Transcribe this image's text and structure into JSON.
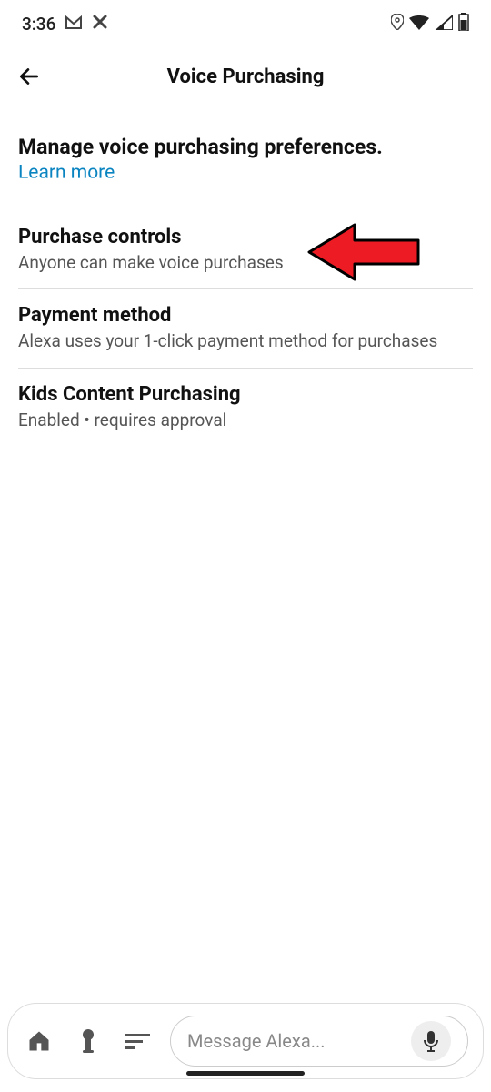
{
  "status": {
    "time": "3:36",
    "icons": {
      "gmail": "M",
      "x": "X"
    }
  },
  "header": {
    "title": "Voice Purchasing"
  },
  "intro": {
    "text": "Manage voice purchasing preferences.",
    "learn_more": "Learn more"
  },
  "settings": [
    {
      "title": "Purchase controls",
      "subtitle": "Anyone can make voice purchases"
    },
    {
      "title": "Payment method",
      "subtitle": "Alexa uses your 1-click payment method for purchases"
    },
    {
      "title": "Kids Content Purchasing",
      "subtitle": "Enabled • requires approval"
    }
  ],
  "bottom": {
    "input_placeholder": "Message Alexa..."
  }
}
